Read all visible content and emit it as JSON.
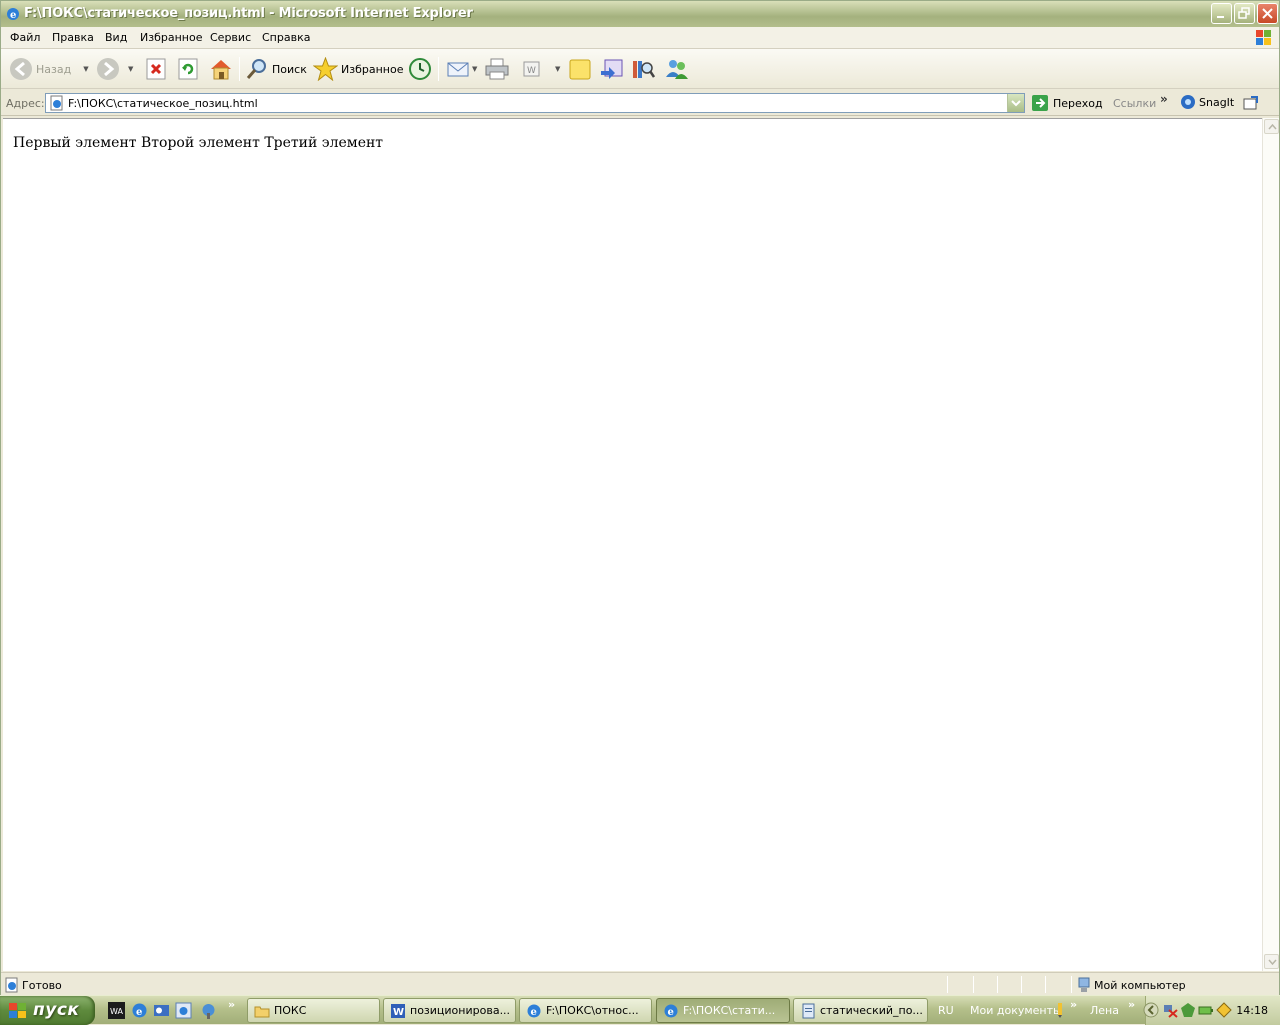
{
  "window": {
    "title": "F:\\ПОКС\\статическое_позиц.html - Microsoft Internet Explorer"
  },
  "menu": [
    "Файл",
    "Правка",
    "Вид",
    "Избранное",
    "Сервис",
    "Справка"
  ],
  "toolbar": {
    "back_label": "Назад",
    "search_label": "Поиск",
    "favorites_label": "Избранное"
  },
  "address": {
    "label": "Адрес:",
    "value": "F:\\ПОКС\\статическое_позиц.html",
    "go_label": "Переход",
    "links_label": "Ссылки",
    "snagit_label": "SnagIt"
  },
  "page": {
    "text": "Первый элемент Второй элемент Третий элемент"
  },
  "status": {
    "text": "Готово",
    "zone": "Мой компьютер"
  },
  "taskbar": {
    "start_label": "пуск",
    "tasks": [
      "ПОКС",
      "позиционирова...",
      "F:\\ПОКС\\относ...",
      "F:\\ПОКС\\стати...",
      "статический_по..."
    ],
    "lang": "RU",
    "docs_label": "Мои документы",
    "user_label": "Лена",
    "clock": "14:18"
  },
  "colors": {
    "title_bar": "#a4b17e",
    "taskbar": "#b5c08b",
    "start_button": "#5e8a3d"
  }
}
